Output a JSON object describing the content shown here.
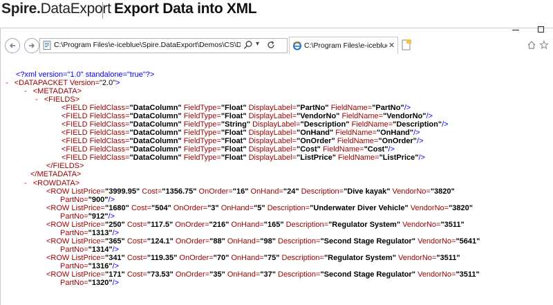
{
  "header": {
    "brand_strong": "Spire.",
    "brand_rest": "DataExport",
    "title": "Export Data into XML"
  },
  "browser": {
    "address": "C:\\Program Files\\e-iceblue\\Spire.DataExport\\Demos\\CS\\Demo\\bin\\D",
    "dropdown_glyph": "▾",
    "tab_title": "C:\\Program Files\\e-iceblue...",
    "tab_close": "✕",
    "accent_color": "#1a73c8"
  },
  "xml": {
    "declaration": "<?xml version=\"1.0\" standalone=\"true\"?>",
    "collapse_marker": "-",
    "lines": {
      "datapacket_open": {
        "tag": "<DATAPACKET",
        "attr": " Version=",
        "value": "\"2.0\"",
        "close": ">"
      },
      "metadata_open": "<METADATA>",
      "fields_open": "<FIELDS>",
      "fields_close": "</FIELDS>",
      "metadata_close": "</METADATA>",
      "rowdata_open": "<ROWDATA>"
    },
    "fields": [
      {
        "FieldClass": "\"DataColumn\"",
        "FieldType": "\"Float\"",
        "DisplayLabel": "\"PartNo\"",
        "FieldName": "\"PartNo\""
      },
      {
        "FieldClass": "\"DataColumn\"",
        "FieldType": "\"Float\"",
        "DisplayLabel": "\"VendorNo\"",
        "FieldName": "\"VendorNo\""
      },
      {
        "FieldClass": "\"DataColumn\"",
        "FieldType": "\"String\"",
        "DisplayLabel": "\"Description\"",
        "FieldName": "\"Description\""
      },
      {
        "FieldClass": "\"DataColumn\"",
        "FieldType": "\"Float\"",
        "DisplayLabel": "\"OnHand\"",
        "FieldName": "\"OnHand\""
      },
      {
        "FieldClass": "\"DataColumn\"",
        "FieldType": "\"Float\"",
        "DisplayLabel": "\"OnOrder\"",
        "FieldName": "\"OnOrder\""
      },
      {
        "FieldClass": "\"DataColumn\"",
        "FieldType": "\"Float\"",
        "DisplayLabel": "\"Cost\"",
        "FieldName": "\"Cost\""
      },
      {
        "FieldClass": "\"DataColumn\"",
        "FieldType": "\"Float\"",
        "DisplayLabel": "\"ListPrice\"",
        "FieldName": "\"ListPrice\""
      }
    ],
    "rows": [
      {
        "ListPrice": "\"3999.95\"",
        "Cost": "\"1356.75\"",
        "OnOrder": "\"16\"",
        "OnHand": "\"24\"",
        "Description": "\"Dive kayak\"",
        "VendorNo": "\"3820\"",
        "PartNo": "\"900\""
      },
      {
        "ListPrice": "\"1680\"",
        "Cost": "\"504\"",
        "OnOrder": "\"3\"",
        "OnHand": "\"5\"",
        "Description": "\"Underwater Diver Vehicle\"",
        "VendorNo": "\"3820\"",
        "PartNo": "\"912\""
      },
      {
        "ListPrice": "\"250\"",
        "Cost": "\"117.5\"",
        "OnOrder": "\"216\"",
        "OnHand": "\"165\"",
        "Description": "\"Regulator System\"",
        "VendorNo": "\"3511\"",
        "PartNo": "\"1313\""
      },
      {
        "ListPrice": "\"365\"",
        "Cost": "\"124.1\"",
        "OnOrder": "\"88\"",
        "OnHand": "\"98\"",
        "Description": "\"Second Stage Regulator\"",
        "VendorNo": "\"5641\"",
        "PartNo": "\"1314\""
      },
      {
        "ListPrice": "\"341\"",
        "Cost": "\"119.35\"",
        "OnOrder": "\"70\"",
        "OnHand": "\"75\"",
        "Description": "\"Regulator System\"",
        "VendorNo": "\"3511\"",
        "PartNo": "\"1316\""
      },
      {
        "ListPrice": "\"171\"",
        "Cost": "\"73.53\"",
        "OnOrder": "\"35\"",
        "OnHand": "\"37\"",
        "Description": "\"Second Stage Regulator\"",
        "VendorNo": "\"3511\"",
        "PartNo": "\"1320\""
      }
    ]
  }
}
